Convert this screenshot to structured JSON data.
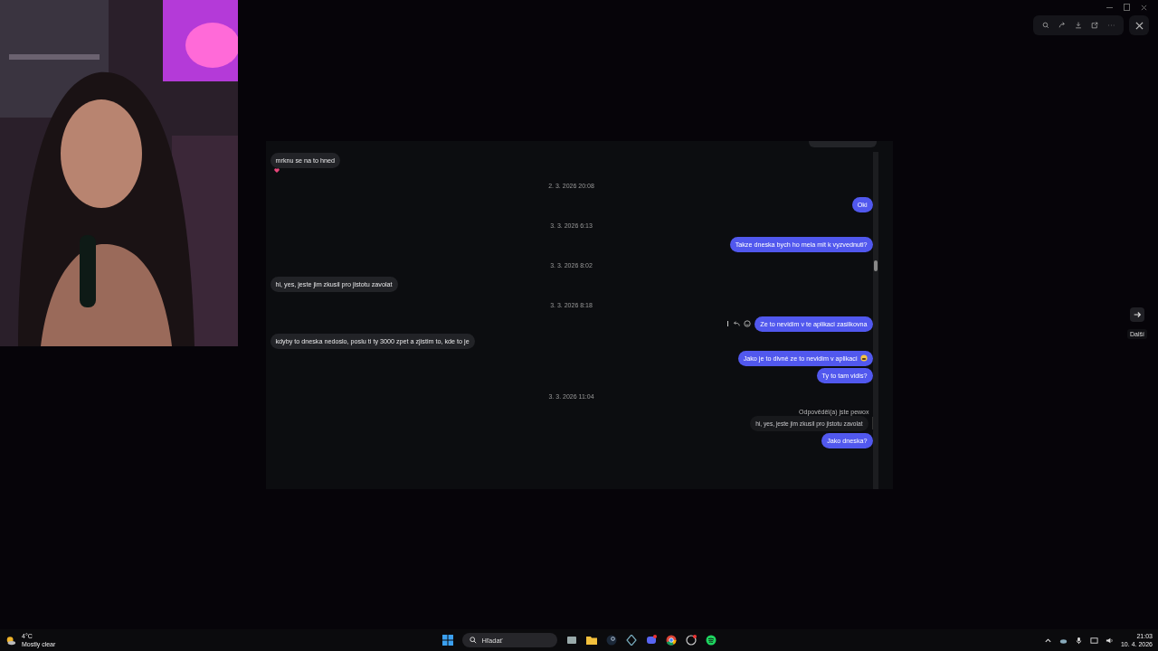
{
  "viewer": {
    "toolbar": [
      {
        "kind": "zoom"
      },
      {
        "kind": "rotate"
      },
      {
        "kind": "download"
      },
      {
        "kind": "open"
      },
      {
        "kind": "more"
      }
    ],
    "next_tooltip": "Další"
  },
  "chat": {
    "items": [
      {
        "kind": "message",
        "outgoing": false,
        "text": "mrknu se na to hned",
        "reaction": true
      },
      {
        "kind": "date",
        "text": "2. 3. 2026 20:08"
      },
      {
        "kind": "message",
        "outgoing": true,
        "text": "Oki"
      },
      {
        "kind": "date",
        "text": "3. 3. 2026 6:13"
      },
      {
        "kind": "message",
        "outgoing": true,
        "text": "Takze dneska bych ho mela mit k vyzvednuti?"
      },
      {
        "kind": "date",
        "text": "3. 3. 2026 8:02"
      },
      {
        "kind": "message",
        "outgoing": false,
        "text": "hi, yes, jeste jim zkusil pro jistotu zavolat"
      },
      {
        "kind": "date",
        "text": "3. 3. 2026 8:18"
      },
      {
        "kind": "message",
        "outgoing": true,
        "text": "Ze to nevidim v te aplikaci zasilkovna",
        "hover_actions": true
      },
      {
        "kind": "message",
        "outgoing": false,
        "text": "kdyby to dneska nedoslo, poslu ti ty 3000 zpet a zjistim to, kde to je"
      },
      {
        "kind": "message",
        "outgoing": true,
        "text": "Jako je to divné ze to nevidim v aplikaci",
        "emoji": true
      },
      {
        "kind": "message",
        "outgoing": true,
        "text": "Ty to tam vidis?"
      },
      {
        "kind": "date",
        "text": "3. 3. 2026 11:04"
      },
      {
        "kind": "reply",
        "label": "Odpověděl(a) jste pewox",
        "quote": "hi, yes, jeste jim zkusil pro jistotu zavolat"
      },
      {
        "kind": "message",
        "outgoing": true,
        "text": "Jako dneska?"
      }
    ]
  },
  "taskbar": {
    "temperature": "4°C",
    "weather": "Mostly clear",
    "search_placeholder": "Hľadať",
    "time": "21:03",
    "date": "10. 4. 2026"
  }
}
